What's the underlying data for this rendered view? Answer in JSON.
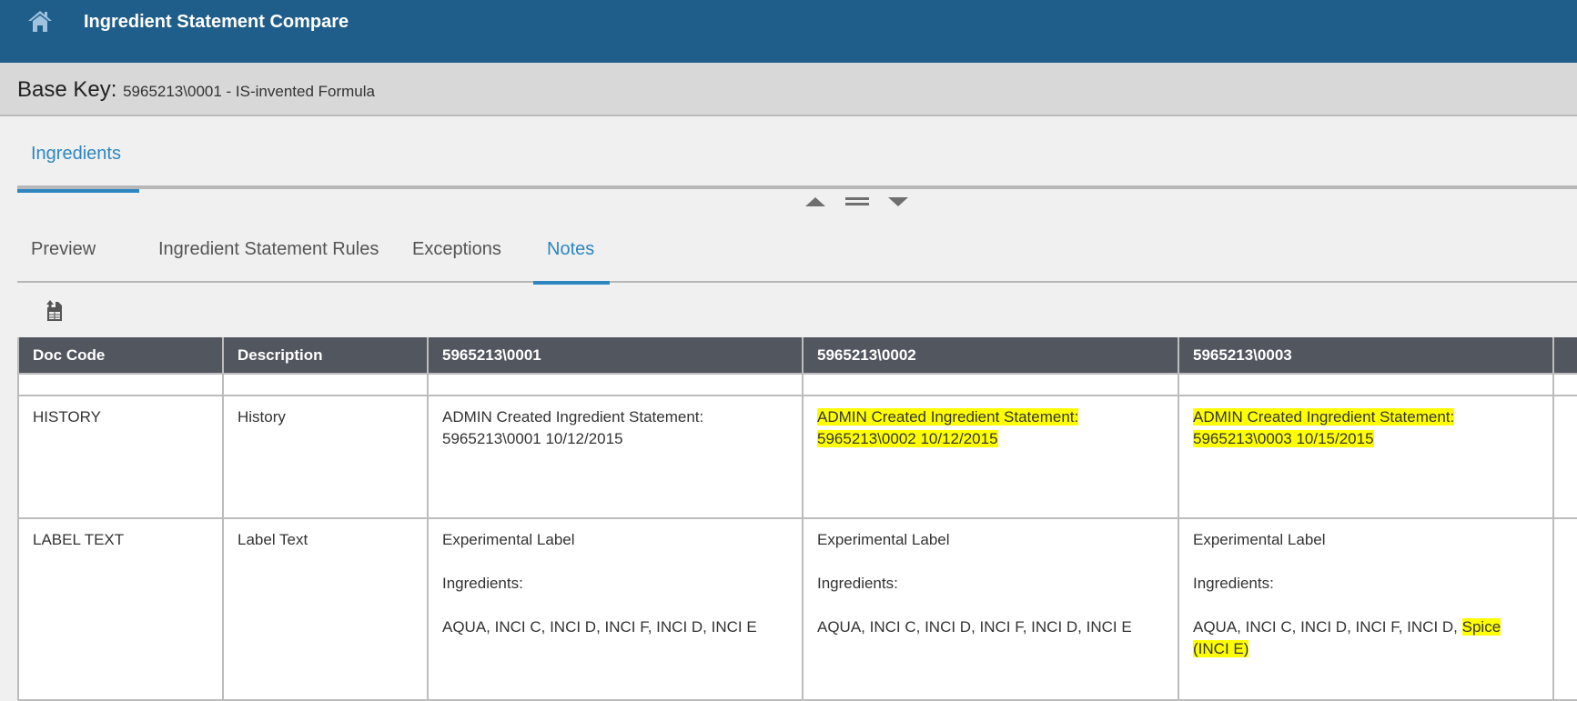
{
  "header": {
    "home_icon": "home-icon",
    "title": "Ingredient Statement Compare"
  },
  "base_key": {
    "label": "Base Key:",
    "value": "5965213\\0001 - IS-invented Formula"
  },
  "main_tabs": [
    {
      "label": "Ingredients",
      "active": true
    }
  ],
  "splitter": {
    "collapse_icon": "triangle-up-icon",
    "drag_icon": "equals-handle-icon",
    "expand_icon": "triangle-down-icon"
  },
  "sub_tabs": [
    {
      "label": "Preview",
      "active": false
    },
    {
      "label": "Ingredient Statement Rules",
      "active": false
    },
    {
      "label": "Exceptions",
      "active": false
    },
    {
      "label": "Notes",
      "active": true
    }
  ],
  "toolbar": {
    "export_icon": "export-spreadsheet-icon"
  },
  "table": {
    "columns": [
      "Doc Code",
      "Description",
      "5965213\\0001",
      "5965213\\0002",
      "5965213\\0003",
      ""
    ],
    "highlight_color": "#ffff00",
    "rows": [
      {
        "doc_code": "HISTORY",
        "description": "History",
        "cells": [
          {
            "lines": [
              "ADMIN Created Ingredient Statement:",
              "5965213\\0001 10/12/2015"
            ],
            "highlighted": false
          },
          {
            "lines": [
              "ADMIN Created Ingredient Statement:",
              "5965213\\0002 10/12/2015"
            ],
            "highlighted": true
          },
          {
            "lines": [
              "ADMIN Created Ingredient Statement:",
              "5965213\\0003 10/15/2015"
            ],
            "highlighted": true
          }
        ]
      },
      {
        "doc_code": "LABEL TEXT",
        "description": "Label Text",
        "cells": [
          {
            "title": "Experimental Label",
            "ingredients_label": "Ingredients:",
            "list": "AQUA, INCI C, INCI D, INCI F, INCI D, INCI E",
            "list_highlight": ""
          },
          {
            "title": "Experimental Label",
            "ingredients_label": "Ingredients:",
            "list": "AQUA, INCI C, INCI D, INCI F, INCI D, INCI E",
            "list_highlight": ""
          },
          {
            "title": "Experimental Label",
            "ingredients_label": "Ingredients:",
            "list": "AQUA, INCI C, INCI D, INCI F, INCI D, ",
            "list_highlight": "Spice (INCI E)"
          }
        ]
      }
    ]
  },
  "colors": {
    "header_bg": "#1f5e8a",
    "accent": "#2e86c1",
    "table_header_bg": "#52565e"
  }
}
